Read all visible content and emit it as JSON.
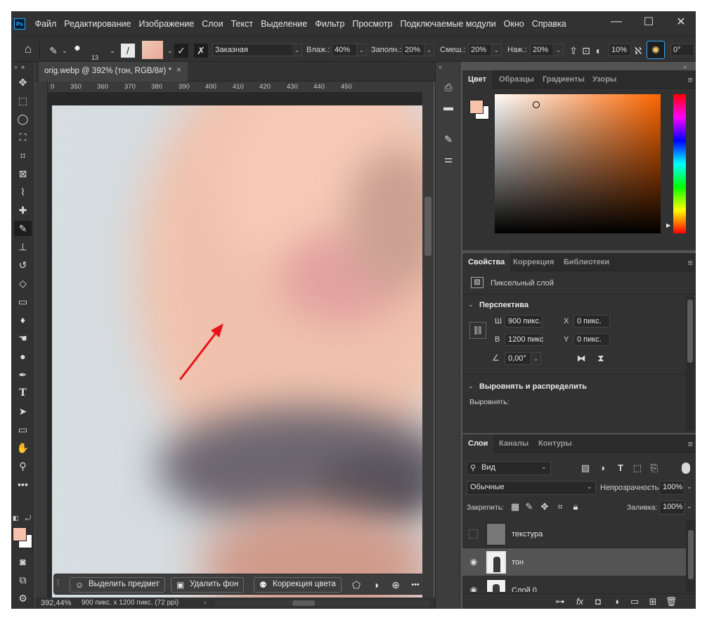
{
  "menubar": {
    "app_logo": "Ps",
    "items": [
      "Файл",
      "Редактирование",
      "Изображение",
      "Слои",
      "Текст",
      "Выделение",
      "Фильтр",
      "Просмотр",
      "Подключаемые модули",
      "Окно",
      "Справка"
    ],
    "minimize_icon": "minimize-icon",
    "maximize_icon": "maximize-icon",
    "close_icon": "close-icon"
  },
  "options_bar": {
    "brush_size": "13",
    "mode": "Заказная",
    "wet_label": "Влаж.:",
    "wet_value": "40%",
    "load_label": "Заполн.:",
    "load_value": "20%",
    "mix_label": "Смеш.:",
    "mix_value": "20%",
    "flow_label": "Наж.:",
    "flow_value": "20%",
    "smoothing_value": "10%",
    "angle_value": "0°"
  },
  "document": {
    "tab_title": "orig.webp @ 392% (тон, RGB/8#) *",
    "close_glyph": "×",
    "ruler_ticks": [
      "0",
      "350",
      "360",
      "370",
      "380",
      "390",
      "400",
      "410",
      "420",
      "430",
      "440",
      "450"
    ],
    "zoom": "392,44%",
    "doc_info": "900 пикс. x 1200 пикс. (72 ppi)"
  },
  "taskbar": {
    "select_subject": "Выделить предмет",
    "remove_bg": "Удалить фон",
    "color_correction": "Коррекция цвета",
    "more": "•••"
  },
  "color_panel": {
    "tabs": [
      "Цвет",
      "Образцы",
      "Градиенты",
      "Узоры"
    ],
    "foreground": "#f7c1ab",
    "background": "#ffffff",
    "hue": "#ff6600"
  },
  "properties_panel": {
    "tabs": [
      "Свойства",
      "Коррекция",
      "Библиотеки"
    ],
    "layer_kind": "Пиксельный слой",
    "transform_title": "Перспектива",
    "w_label": "Ш",
    "w_value": "900 пикс.",
    "h_label": "В",
    "h_value": "1200 пикс",
    "x_label": "X",
    "x_value": "0 пикс.",
    "y_label": "Y",
    "y_value": "0 пикс.",
    "angle_value": "0,00°",
    "align_title": "Выровнять и распределить",
    "align_label": "Выровнять:"
  },
  "layers_panel": {
    "tabs": [
      "Слои",
      "Каналы",
      "Контуры"
    ],
    "filter_kind": "Вид",
    "blend_mode": "Обычные",
    "opacity_label": "Непрозрачность:",
    "opacity_value": "100%",
    "lock_label": "Закрепить:",
    "fill_label": "Заливка:",
    "fill_value": "100%",
    "layers": [
      {
        "name": "текстура",
        "visible": false,
        "selected": false
      },
      {
        "name": "тон",
        "visible": true,
        "selected": true
      },
      {
        "name": "Слой 0",
        "visible": true,
        "selected": false
      }
    ]
  }
}
